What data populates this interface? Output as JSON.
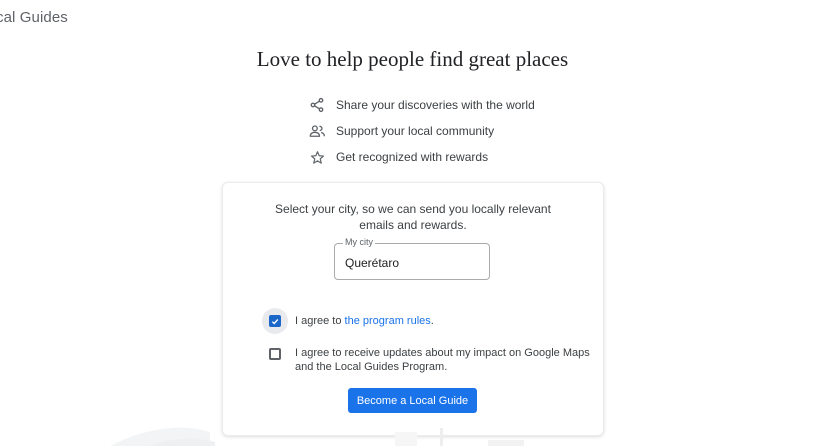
{
  "brand": {
    "title": "cal Guides"
  },
  "hero": {
    "headline": "Love to help people find great places"
  },
  "benefits": [
    {
      "icon": "share-icon",
      "label": "Share your discoveries with the world"
    },
    {
      "icon": "community-icon",
      "label": "Support your local community"
    },
    {
      "icon": "star-icon",
      "label": "Get recognized with rewards"
    }
  ],
  "signup": {
    "intro_line1": "Select your city, so we can send you locally relevant",
    "intro_line2": "emails and rewards.",
    "city_label": "My city",
    "city_value": "Querétaro",
    "agree_rules_prefix": "I agree to ",
    "agree_rules_link": "the program rules",
    "agree_rules_suffix": ".",
    "agree_rules_checked": true,
    "updates_line1": "I agree to receive updates about my impact on Google Maps",
    "updates_line2": "and the Local Guides Program.",
    "updates_checked": false,
    "submit_label": "Become a Local Guide"
  },
  "colors": {
    "accent": "#1a73e8",
    "checkbox_checked": "#1a66c9",
    "text": "#3c4043",
    "headline": "#202124"
  }
}
